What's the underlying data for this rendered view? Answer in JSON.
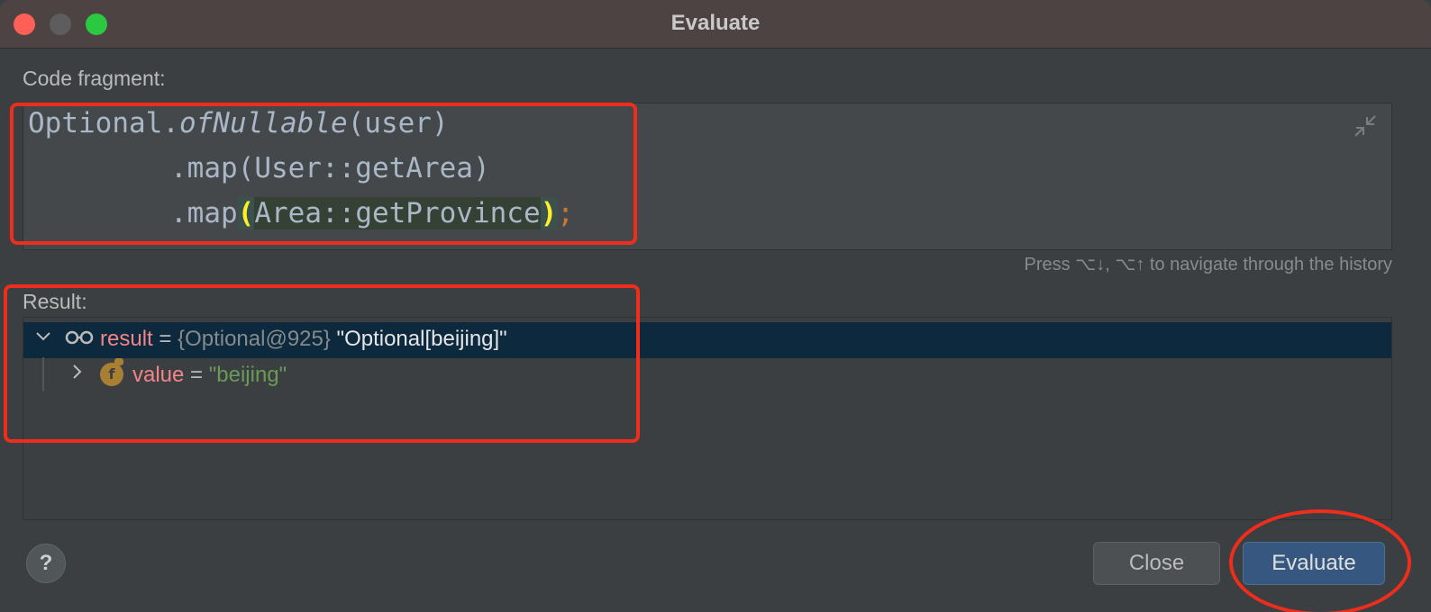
{
  "window": {
    "title": "Evaluate"
  },
  "code_fragment": {
    "label": "Code fragment:",
    "line1_a": "Optional.",
    "line1_b": "ofNullable",
    "line1_c": "(user)",
    "line2": ".map(User::getArea)",
    "line3_a": ".map",
    "line3_paren_open": "(",
    "line3_b": "Area::",
    "line3_c": "getProvince",
    "line3_paren_close": ")",
    "line3_semi": ";",
    "collapse_icon": "collapse-icon"
  },
  "hint": "Press ⌥↓, ⌥↑ to navigate through the history",
  "result": {
    "label": "Result:",
    "rows": [
      {
        "name": "result",
        "eq": " = ",
        "type": "{Optional@925}",
        "value": " \"Optional[beijing]\"",
        "icon": "watch-glasses-icon"
      },
      {
        "name": "value",
        "eq": " = ",
        "value": "\"beijing\"",
        "icon": "field-icon",
        "icon_glyph": "f"
      }
    ]
  },
  "buttons": {
    "help": "?",
    "close": "Close",
    "evaluate": "Evaluate"
  },
  "colors": {
    "annotation": "#ef2d1c",
    "selection": "#0d293e",
    "primary_button": "#365880"
  }
}
